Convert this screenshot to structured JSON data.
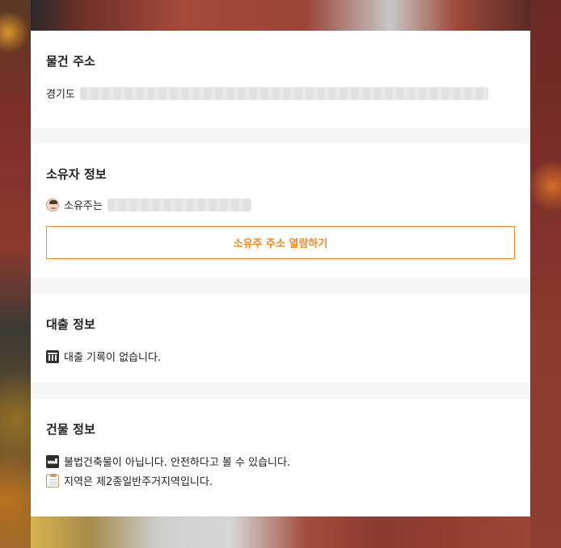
{
  "property_address": {
    "title": "물건 주소",
    "prefix": "경기도"
  },
  "owner_info": {
    "title": "소유자 정보",
    "owner_label": "소유주는",
    "reveal_button": "소유주 주소 열람하기"
  },
  "loan_info": {
    "title": "대출 정보",
    "no_loan": "대출 기록이 없습니다."
  },
  "building_info": {
    "title": "건물 정보",
    "illegal_status": "불법건축물이 아닙니다. 안전하다고 볼 수 있습니다.",
    "zone_status": "지역은 제2종일반주거지역입니다."
  },
  "colors": {
    "accent": "#f08a24",
    "divider_bg": "#f6f6f6"
  },
  "icons": {
    "owner": "person-face-icon",
    "loan": "bank-icon",
    "building": "factory-icon",
    "zone": "clipboard-icon"
  }
}
